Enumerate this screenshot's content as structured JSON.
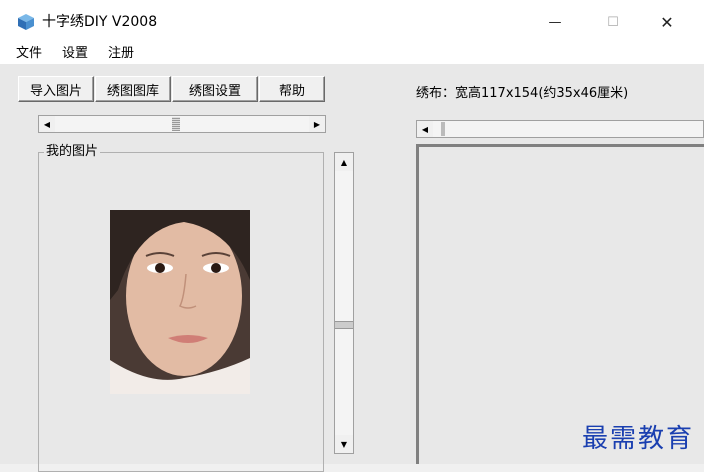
{
  "window": {
    "title": "十字绣DIY V2008",
    "min_glyph": "—",
    "max_glyph": "☐",
    "close_glyph": "✕"
  },
  "menu": [
    "文件",
    "设置",
    "注册"
  ],
  "toolbar": [
    "导入图片",
    "绣图图库",
    "绣图设置",
    "帮助"
  ],
  "left_panel": {
    "group_label": "我的图片",
    "photo_icon": "portrait-photo"
  },
  "right_panel": {
    "cloth_info": "绣布：宽高117x154(约35x46厘米)"
  },
  "watermark": "最需教育",
  "colors": {
    "accent": "#1a3fb0",
    "client_bg": "#e8e8e8"
  }
}
